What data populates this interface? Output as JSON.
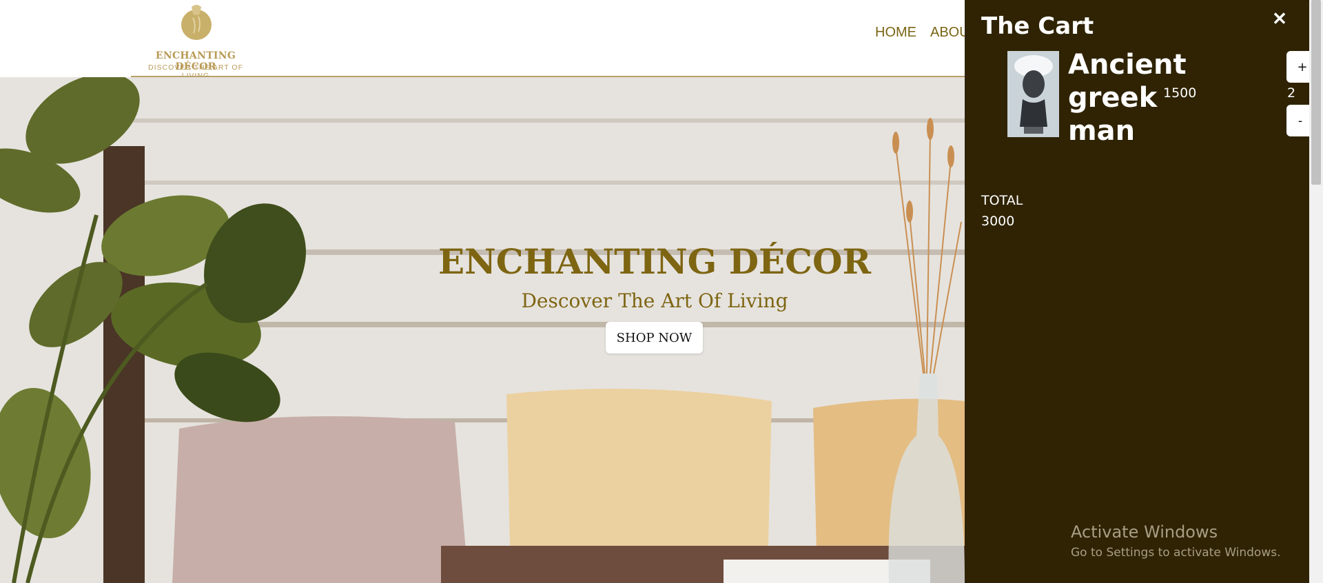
{
  "brand": {
    "name": "ENCHANTING DÉCOR",
    "tagline": "DISCOVER THE ART OF LIVING",
    "logo_icon": "vase-logo-icon",
    "color": "#b89a55"
  },
  "nav": {
    "items": [
      {
        "label": "HOME"
      },
      {
        "label": "ABOUT"
      }
    ]
  },
  "hero": {
    "title": "ENCHANTING DÉCOR",
    "subtitle": "Descover The Art Of Living",
    "cta_label": "SHOP NOW",
    "title_color": "#7e6512"
  },
  "cart": {
    "title": "The Cart",
    "close_icon": "close-icon",
    "items": [
      {
        "name": "Ancient greek man",
        "price": "1500",
        "quantity": "2",
        "plus_label": "+",
        "minus_label": "-",
        "image_icon": "greek-bust-image"
      }
    ],
    "total_label": "TOTAL",
    "total_value": "3000",
    "background": "#2f2303"
  },
  "windows_notice": {
    "title": "Activate Windows",
    "subtitle": "Go to Settings to activate Windows."
  }
}
